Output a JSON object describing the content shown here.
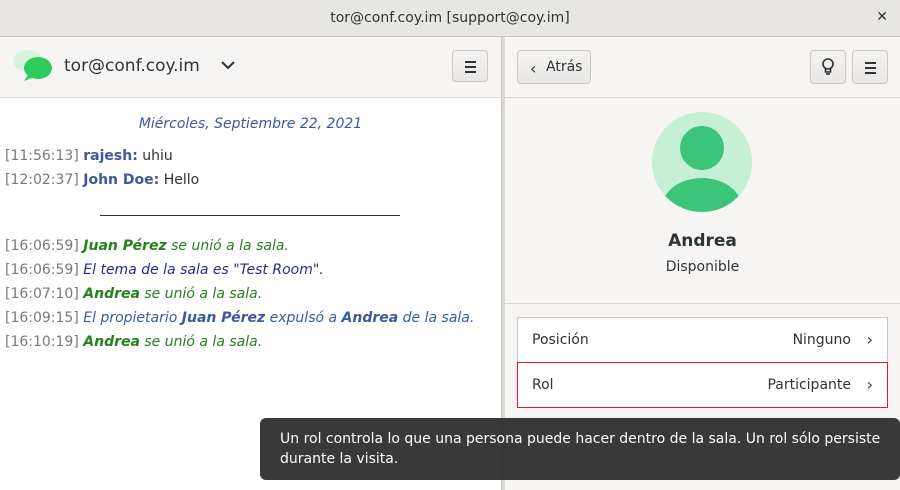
{
  "window": {
    "title": "tor@conf.coy.im [support@coy.im]"
  },
  "left_header": {
    "account": "tor@conf.coy.im"
  },
  "chat": {
    "date": "Miércoles, Septiembre 22, 2021",
    "messages": [
      {
        "time": "[11:56:13]",
        "nick": "rajesh:",
        "text": "uhiu"
      },
      {
        "time": "[12:02:37]",
        "nick": "John Doe:",
        "text": "Hello"
      }
    ],
    "events": [
      {
        "time": "[16:06:59]",
        "who": "Juan Pérez",
        "text": "se unió a la sala."
      },
      {
        "time": "[16:06:59]",
        "text": "El tema de la sala es \"Test Room\"."
      },
      {
        "time": "[16:07:10]",
        "who": "Andrea",
        "text": "se unió a la sala."
      },
      {
        "time": "[16:09:15]",
        "pre": "El propietario",
        "owner": "Juan Pérez",
        "mid": "expulsó a",
        "target": "Andrea",
        "post": "de la sala."
      },
      {
        "time": "[16:10:19]",
        "who": "Andrea",
        "text": "se unió a la sala."
      }
    ]
  },
  "right_panel": {
    "back_label": "Atrás",
    "name": "Andrea",
    "status": "Disponible",
    "rows": [
      {
        "label": "Posición",
        "value": "Ninguno"
      },
      {
        "label": "Rol",
        "value": "Participante"
      }
    ]
  },
  "tooltip": {
    "text": "Un rol controla lo que una persona puede hacer dentro de la sala. Un rol sólo persiste durante la visita."
  },
  "colors": {
    "accent": "#3a5a9b",
    "join": "#26801f",
    "avatar": "#c6f0d5",
    "avatar_fg": "#3cc47a",
    "highlight": "#e01b24"
  },
  "icons": {
    "logo": "chat-bubbles-icon",
    "dropdown": "chevron-down-icon",
    "menu": "hamburger-menu-icon",
    "back": "chevron-left-icon",
    "bulb": "lightbulb-icon",
    "row": "chevron-right-icon",
    "close": "close-icon"
  }
}
